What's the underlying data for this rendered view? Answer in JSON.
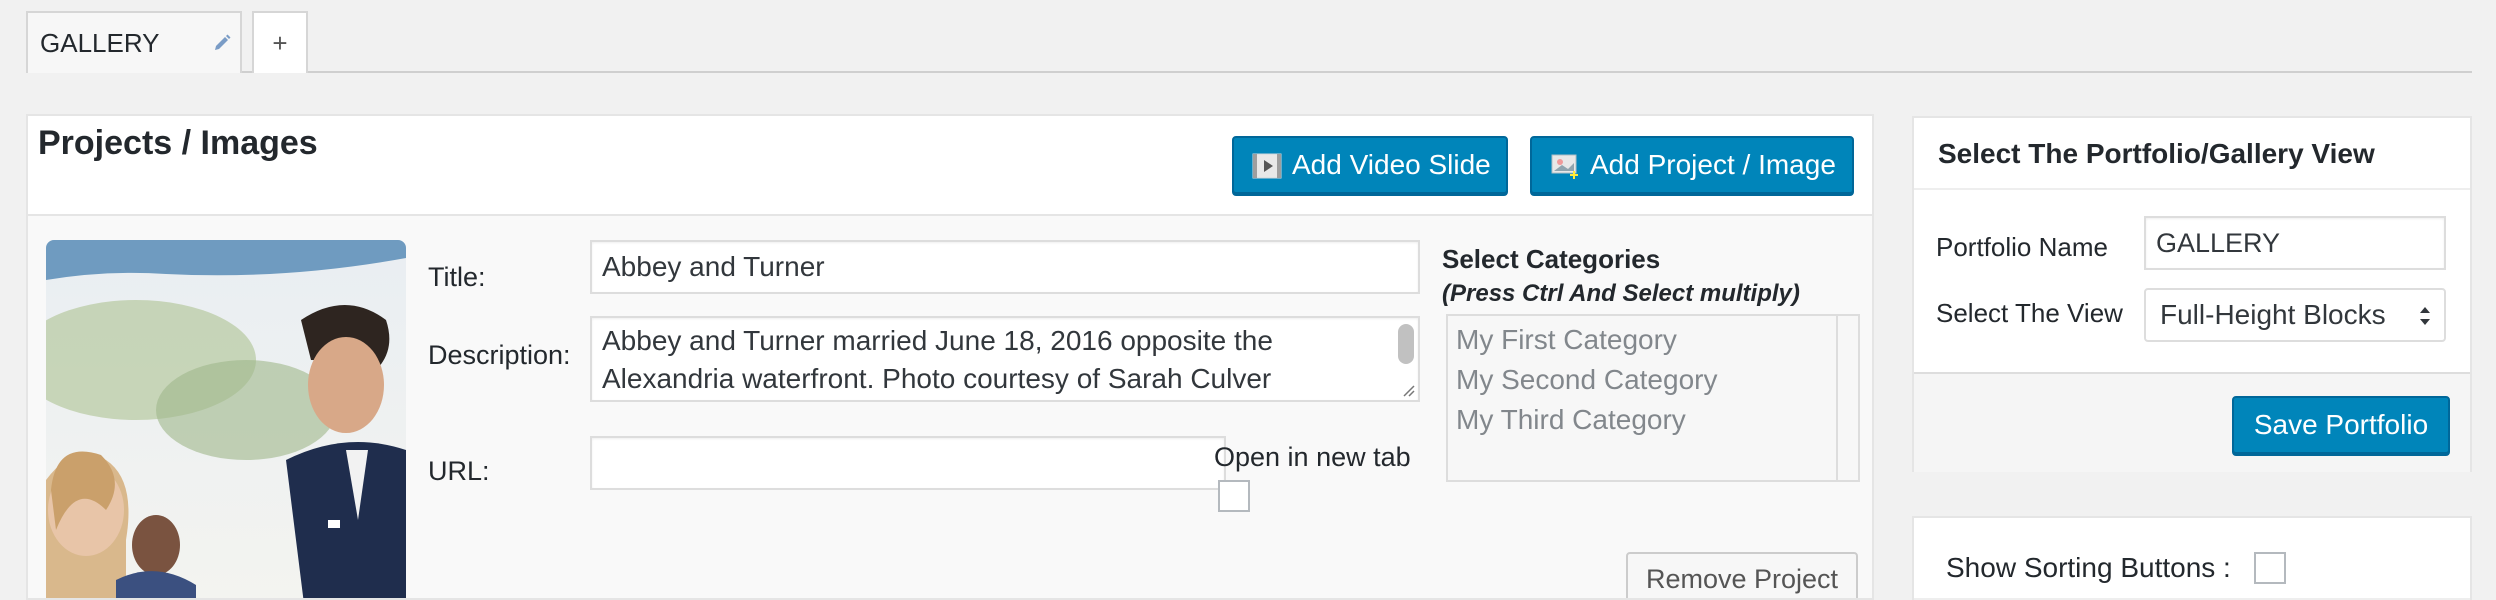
{
  "tabs": [
    {
      "label": "GALLERY",
      "icon": "pencil-icon"
    },
    {
      "label": "+"
    }
  ],
  "main": {
    "title": "Projects / Images",
    "buttons": {
      "add_video": "Add Video Slide",
      "add_project": "Add Project / Image"
    },
    "project": {
      "title_label": "Title:",
      "title_value": "Abbey and Turner",
      "description_label": "Description:",
      "description_value": "Abbey and Turner married June 18, 2016 opposite the Alexandria waterfront. Photo courtesy of Sarah Culver",
      "url_label": "URL:",
      "url_value": "",
      "open_new_tab_label": "Open in new tab",
      "open_new_tab_checked": false,
      "categories_title": "Select Categories",
      "categories_hint": "(Press Ctrl And Select multiply)",
      "categories": [
        "My First Category",
        "My Second Category",
        "My Third Category"
      ],
      "remove_label": "Remove Project"
    }
  },
  "sidebar": {
    "title": "Select The Portfolio/Gallery View",
    "portfolio_name_label": "Portfolio Name",
    "portfolio_name_value": "GALLERY",
    "view_label": "Select The View",
    "view_value": "Full-Height Blocks",
    "save_label": "Save Portfolio",
    "sorting_label": "Show Sorting Buttons :",
    "sorting_checked": false
  },
  "colors": {
    "primary_button": "#0085ba",
    "background": "#f1f1f1"
  }
}
